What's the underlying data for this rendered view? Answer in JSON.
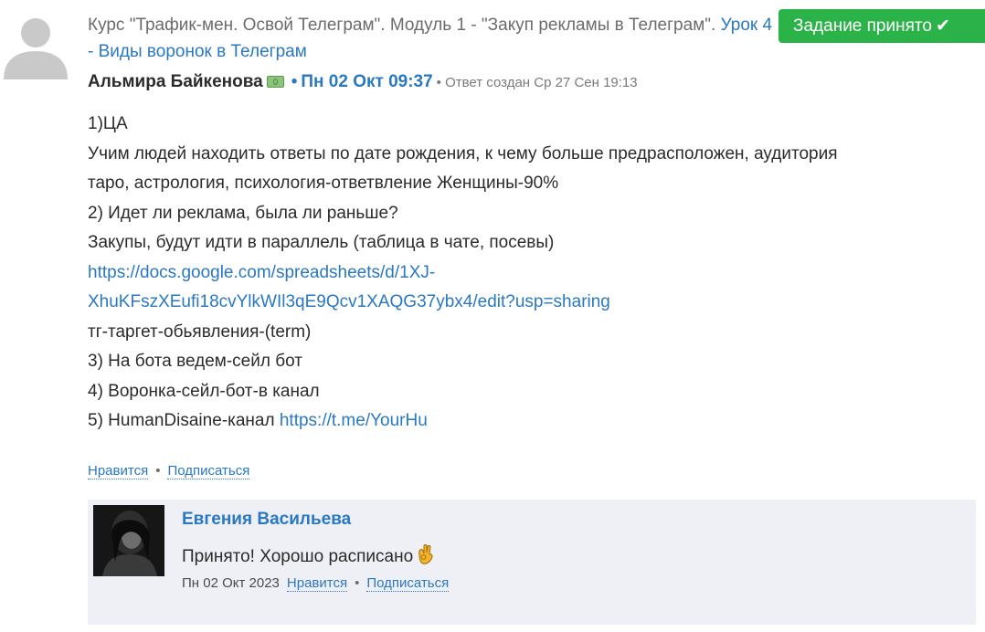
{
  "post": {
    "course_text": "Курс \"Трафик-мен. Освой Телеграм\". Модуль 1 - \"Закуп рекламы в Телеграм\".",
    "lesson_link": "Урок 4 - Виды воронок в Телеграм",
    "status_badge": "Задание принято",
    "author": "Альмира Байкенова",
    "bullet": "•",
    "date": "Пн 02 Окт 09:37",
    "created": "• Ответ создан Ср 27 Сен 19:13",
    "lines": [
      "1)ЦА",
      "Учим людей находить ответы по дате рождения, к чему больше предрасположен, аудитория",
      "таро, астрология, психология-ответвление Женщины-90%",
      "2) Идет ли реклама, была ли раньше?",
      "Закупы, будут идти в параллель (таблица в чате, посевы)"
    ],
    "sheet_link_1": "https://docs.google.com/spreadsheets/d/1XJ-",
    "sheet_link_2": "XhuKFszXEufi18cvYlkWIl3qE9Qcv1XAQG37ybx4/edit?usp=sharing",
    "lines_after": [
      "тг-таргет-обьявления-(term)",
      "3) На бота ведем-сейл бот",
      "4) Воронка-сейл-бот-в канал"
    ],
    "line5_text": "5) HumanDisaine-канал ",
    "line5_link": "https://t.me/YourHu",
    "like_label": "Нравится",
    "separator": "•",
    "subscribe_label": "Подписаться"
  },
  "reply": {
    "author": "Евгения Васильева",
    "text": "Принято! Хорошо расписано",
    "date": "Пн 02 Окт 2023",
    "like_label": "Нравится",
    "separator": "•",
    "subscribe_label": "Подписаться"
  },
  "icons": {
    "avatar_placeholder": "user-silhouette-icon",
    "badge_check": "check-icon",
    "money": "money-icon",
    "emoji": "ok-hand-icon"
  },
  "colors": {
    "link": "#2a78c2",
    "badge": "#2bb34a",
    "reply_bg": "#eef0f5"
  }
}
